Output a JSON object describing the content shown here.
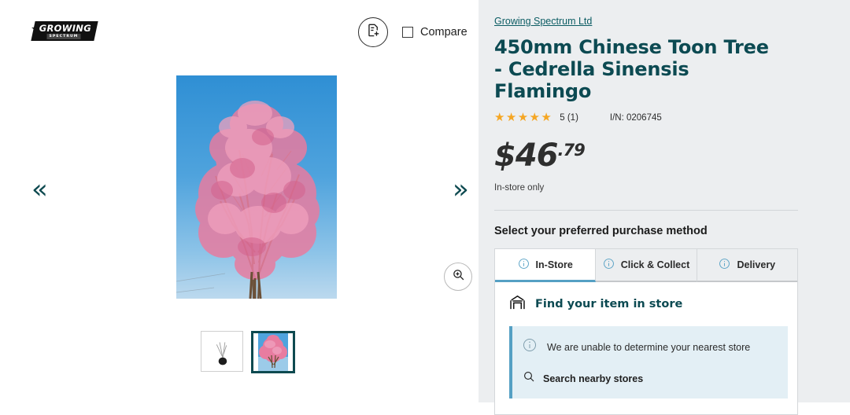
{
  "gallery": {
    "logo": {
      "main": "GROWING",
      "sub": "SPECTRUM"
    },
    "add_to_list_icon": "document-plus-icon",
    "compare_label": "Compare",
    "prev_arrow": "«",
    "next_arrow": "»",
    "zoom_icon": "magnifier-plus-icon",
    "thumbnails": [
      {
        "name": "sapling-thumbnail",
        "selected": false
      },
      {
        "name": "blossom-tree-thumbnail",
        "selected": true
      }
    ]
  },
  "details": {
    "brand": "Growing Spectrum Ltd",
    "title": "450mm Chinese Toon Tree - Cedrella Sinensis Flamingo",
    "stars": "★★★★★",
    "rating_text": "5 (1)",
    "item_number": "I/N: 0206745",
    "price_dollars": "$46",
    "price_cents": ".79",
    "stock_note": "In-store only",
    "section_heading": "Select your preferred purchase method",
    "tabs": [
      {
        "label": "In-Store",
        "active": true
      },
      {
        "label": "Click & Collect",
        "active": false
      },
      {
        "label": "Delivery",
        "active": false
      }
    ],
    "panel": {
      "heading": "Find your item in store",
      "store_icon": "storefront-icon",
      "alert_text": "We are unable to determine your nearest store",
      "search_link": "Search nearby stores"
    }
  },
  "colors": {
    "brand_teal": "#0c4a52",
    "accent_blue": "#55a0c4",
    "star_amber": "#f5a623",
    "panel_bg": "#eceef0",
    "alert_bg": "#e3eff5"
  }
}
